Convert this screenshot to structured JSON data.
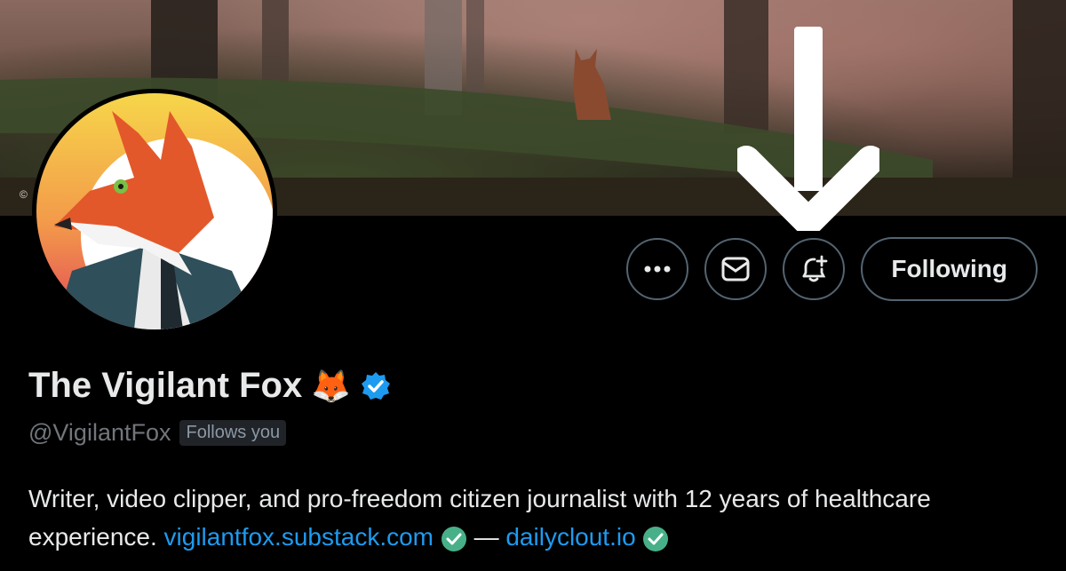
{
  "banner": {
    "copyright": "©"
  },
  "actions": {
    "more_label": "…",
    "message_icon": "mail-icon",
    "notify_icon": "bell-plus-icon",
    "following_label": "Following"
  },
  "profile": {
    "name": "The Vigilant Fox",
    "emoji": "🦊",
    "handle": "@VigilantFox",
    "follows_you": "Follows you",
    "bio_text": "Writer, video clipper, and pro-freedom citizen journalist with 12 years of healthcare experience. ",
    "link1": "vigilantfox.substack.com",
    "separator": " — ",
    "link2": "dailyclout.io"
  },
  "colors": {
    "accent": "#1d9bf0",
    "verified": "#1d9bf0",
    "link_check": "#00ba7c"
  }
}
